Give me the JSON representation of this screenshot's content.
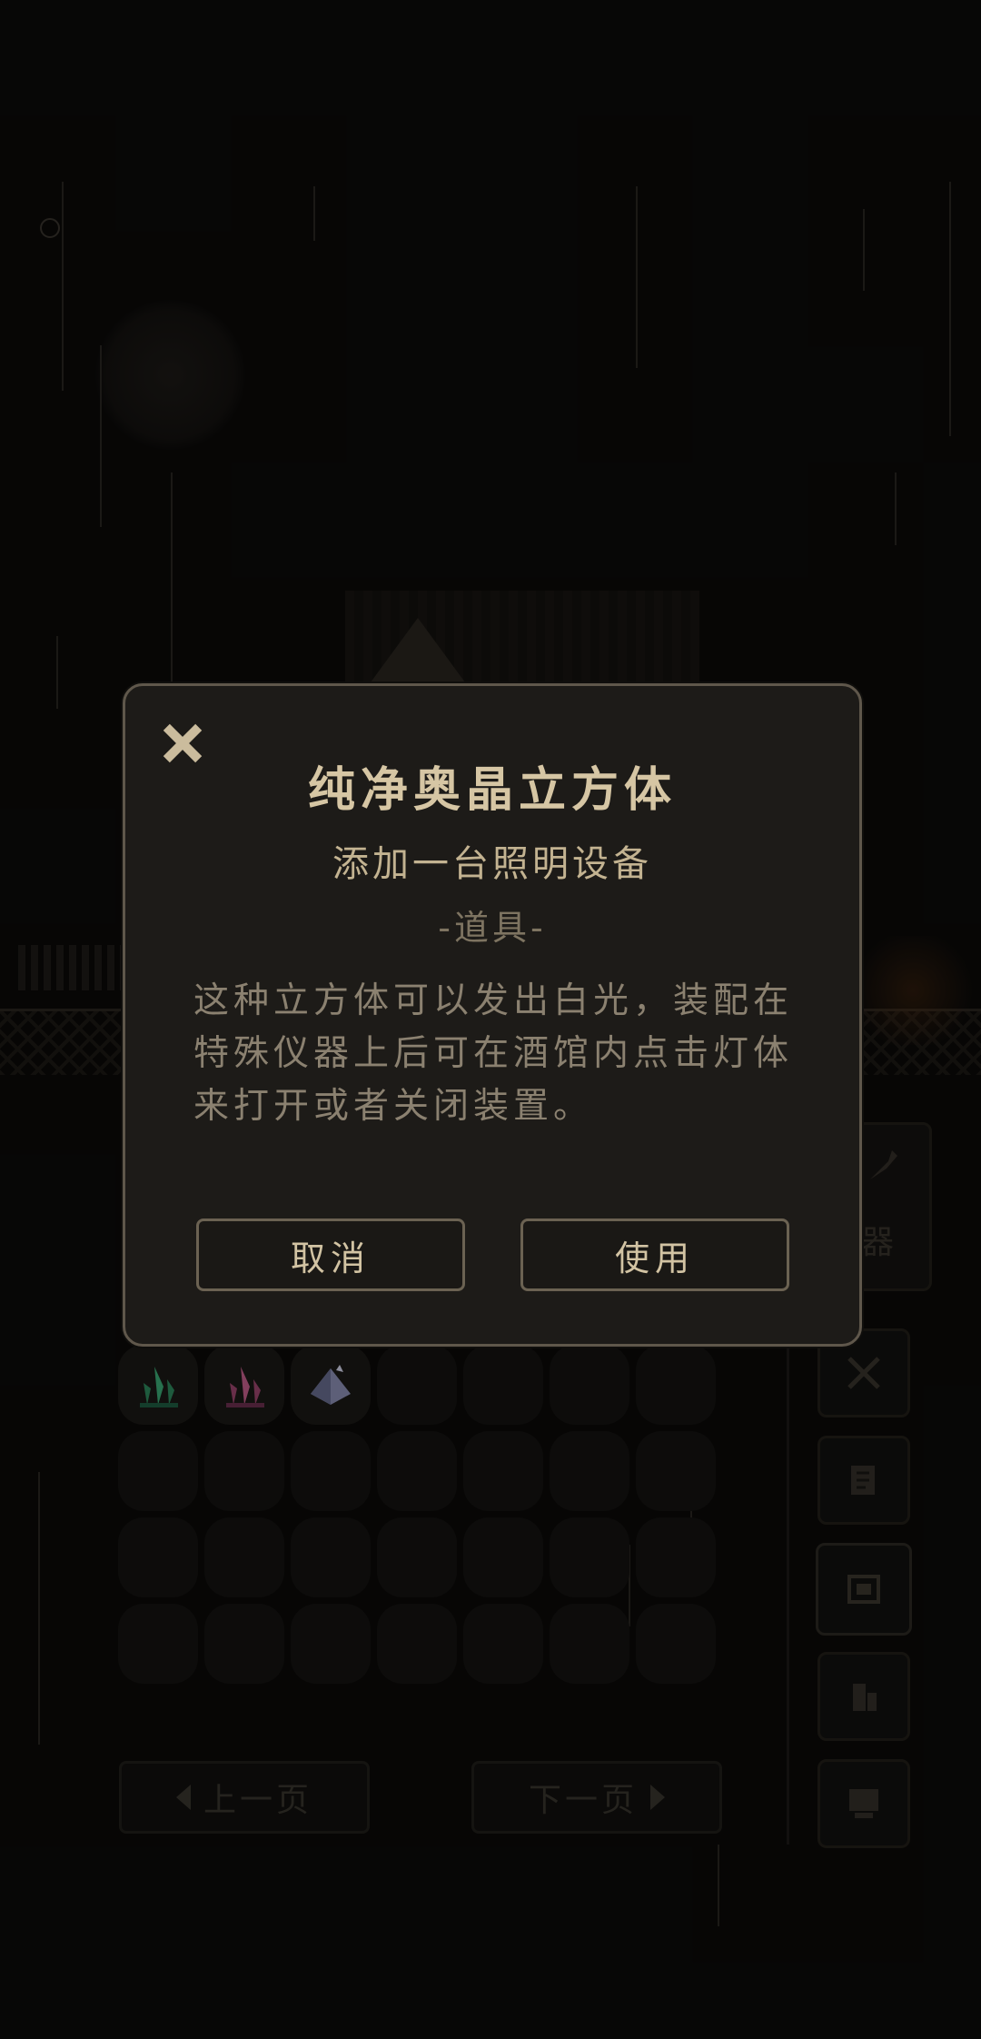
{
  "modal": {
    "title": "纯净奥晶立方体",
    "subtitle": "添加一台照明设备",
    "category": "-道具-",
    "description": "这种立方体可以发出白光，装配在特殊仪器上后可在酒馆内点击灯体来打开或者关闭装置。",
    "cancel_label": "取消",
    "use_label": "使用",
    "close_icon": "close-icon"
  },
  "inventory": {
    "items": [
      {
        "icon": "green-crystal-icon",
        "color": "#2f8a5e"
      },
      {
        "icon": "pink-crystal-icon",
        "color": "#b0507a"
      },
      {
        "icon": "white-cube-crystal-icon",
        "color": "#8f93b8"
      }
    ],
    "prev_label": "上一页",
    "next_label": "下一页"
  },
  "side_tabs": {
    "partial_label": "器",
    "icons": [
      "sword-icon",
      "scroll-icon",
      "cabinet-icon",
      "furniture-icon",
      "computer-icon"
    ]
  }
}
